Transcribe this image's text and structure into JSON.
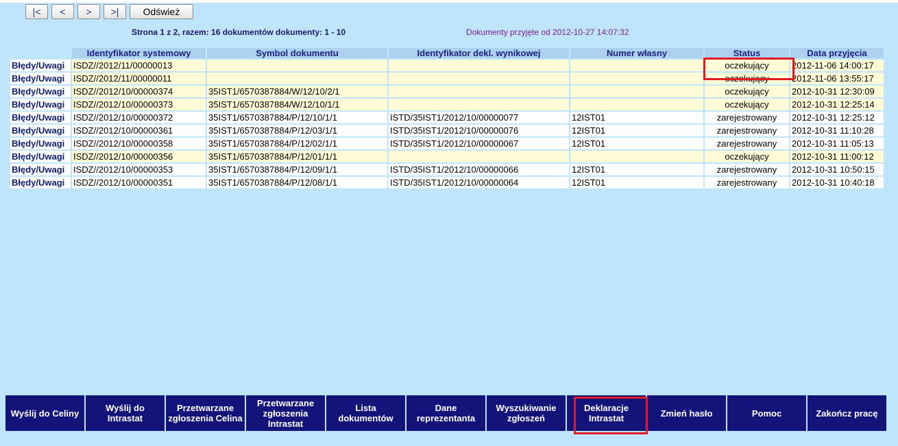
{
  "nav": {
    "first": "|<",
    "prev": "<",
    "next": ">",
    "last": ">|",
    "refresh": "Odśwież"
  },
  "info": {
    "pages": "Strona 1 z 2, razem: 16 dokumentów dokumenty: 1 - 10",
    "since": "Dokumenty przyjęte od 2012-10-27 14:07:32"
  },
  "table": {
    "headers": [
      "Identyfikator systemowy",
      "Symbol dokumentu",
      "Identyfikator dekl. wynikowej",
      "Numer własny",
      "Status",
      "Data przyjęcia"
    ],
    "link_label": "Błędy/Uwagi",
    "rows": [
      {
        "id": "ISDZ//2012/11/00000013",
        "symbol": "",
        "decl": "",
        "own": "",
        "status": "oczekujący",
        "date": "2012-11-06 14:00:17"
      },
      {
        "id": "ISDZ//2012/11/00000011",
        "symbol": "",
        "decl": "",
        "own": "",
        "status": "oczekujący",
        "date": "2012-11-06 13:55:17"
      },
      {
        "id": "ISDZ//2012/10/00000374",
        "symbol": "35IST1/6570387884/W/12/10/2/1",
        "decl": "",
        "own": "",
        "status": "oczekujący",
        "date": "2012-10-31 12:30:09"
      },
      {
        "id": "ISDZ//2012/10/00000373",
        "symbol": "35IST1/6570387884/W/12/10/1/1",
        "decl": "",
        "own": "",
        "status": "oczekujący",
        "date": "2012-10-31 12:25:14"
      },
      {
        "id": "ISDZ//2012/10/00000372",
        "symbol": "35IST1/6570387884/P/12/10/1/1",
        "decl": "ISTD/35IST1/2012/10/00000077",
        "own": "12IST01",
        "status": "zarejestrowany",
        "date": "2012-10-31 12:25:12"
      },
      {
        "id": "ISDZ//2012/10/00000361",
        "symbol": "35IST1/6570387884/P/12/03/1/1",
        "decl": "ISTD/35IST1/2012/10/00000076",
        "own": "12IST01",
        "status": "zarejestrowany",
        "date": "2012-10-31 11:10:28"
      },
      {
        "id": "ISDZ//2012/10/00000358",
        "symbol": "35IST1/6570387884/P/12/02/1/1",
        "decl": "ISTD/35IST1/2012/10/00000067",
        "own": "12IST01",
        "status": "zarejestrowany",
        "date": "2012-10-31 11:05:13"
      },
      {
        "id": "ISDZ//2012/10/00000356",
        "symbol": "35IST1/6570387884/P/12/01/1/1",
        "decl": "",
        "own": "",
        "status": "oczekujący",
        "date": "2012-10-31 11:00:12"
      },
      {
        "id": "ISDZ//2012/10/00000353",
        "symbol": "35IST1/6570387884/P/12/09/1/1",
        "decl": "ISTD/35IST1/2012/10/00000066",
        "own": "12IST01",
        "status": "zarejestrowany",
        "date": "2012-10-31 10:50:15"
      },
      {
        "id": "ISDZ//2012/10/00000351",
        "symbol": "35IST1/6570387884/P/12/08/1/1",
        "decl": "ISTD/35IST1/2012/10/00000064",
        "own": "12IST01",
        "status": "zarejestrowany",
        "date": "2012-10-31 10:40:18"
      }
    ]
  },
  "menu": [
    {
      "label": "Wyślij do Celiny",
      "name": "send-to-celina-button"
    },
    {
      "label": "Wyślij do Intrastat",
      "name": "send-to-intrastat-button"
    },
    {
      "label": "Przetwarzane zgłoszenia Celina",
      "name": "processed-celina-button"
    },
    {
      "label": "Przetwarzane zgłoszenia Intrastat",
      "name": "processed-intrastat-button"
    },
    {
      "label": "Lista dokumentów",
      "name": "document-list-button"
    },
    {
      "label": "Dane reprezentanta",
      "name": "representative-data-button"
    },
    {
      "label": "Wyszukiwanie zgłoszeń",
      "name": "search-declarations-button"
    },
    {
      "label": "Deklaracje Intrastat",
      "name": "intrastat-declarations-button"
    },
    {
      "label": "Zmień hasło",
      "name": "change-password-button"
    },
    {
      "label": "Pomoc",
      "name": "help-button"
    },
    {
      "label": "Zakończ pracę",
      "name": "logout-button"
    }
  ],
  "colors": {
    "background": "#bfe5fd",
    "header": "#aed1f2",
    "pending_row": "#fffbd6",
    "menu": "#14137a",
    "highlight": "#e11b22"
  }
}
